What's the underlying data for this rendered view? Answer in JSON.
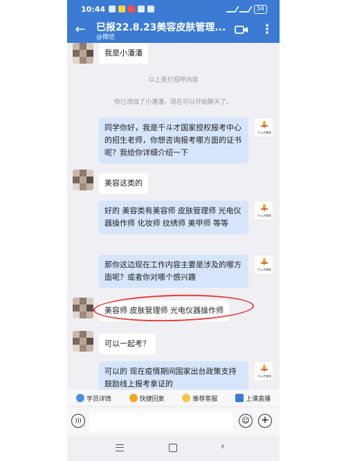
{
  "status_bar": {
    "time": "10:44",
    "battery": "34"
  },
  "header": {
    "title": "已报22.8.23美容皮肤管理...",
    "subtitle": "@微信"
  },
  "messages": {
    "intro": "我是小潘潘",
    "sys_greeting": "以上是打招呼内容",
    "sys_added": "你已添加了小潘潘，现在可以开始聊天了。",
    "m1": "同学你好，我是千斗才国家授权报考中心的招生老师，你想咨询报考哪方面的证书呢？我给你详细介绍一下",
    "m2": "美容这类的",
    "m3": "好的 美容类有美容师 皮肤管理师 光电仪器操作师 化妆师 纹绣师 美甲师 等等",
    "m4": "那你这边现在工作内容主要是涉及的哪方面呢？或者你对哪个感兴趣",
    "m5": "美容师 皮肤管理师 光电仪器操作师",
    "m6": "可以一起考？",
    "m7": "可以的 现在疫情期间国家出台政策支持鼓励线上报考拿证的"
  },
  "logo_text": "千斗才教育",
  "quick_actions": {
    "student_info": "学员详情",
    "quick_reply": "快捷回复",
    "recommend_service": "推荐客服",
    "live_class": "上课直播"
  },
  "input": {
    "placeholder": ""
  },
  "colors": {
    "header_bg": "#3b7bd4",
    "bubble_right": "#d6e5fb",
    "highlight_circle": "#e53935"
  }
}
